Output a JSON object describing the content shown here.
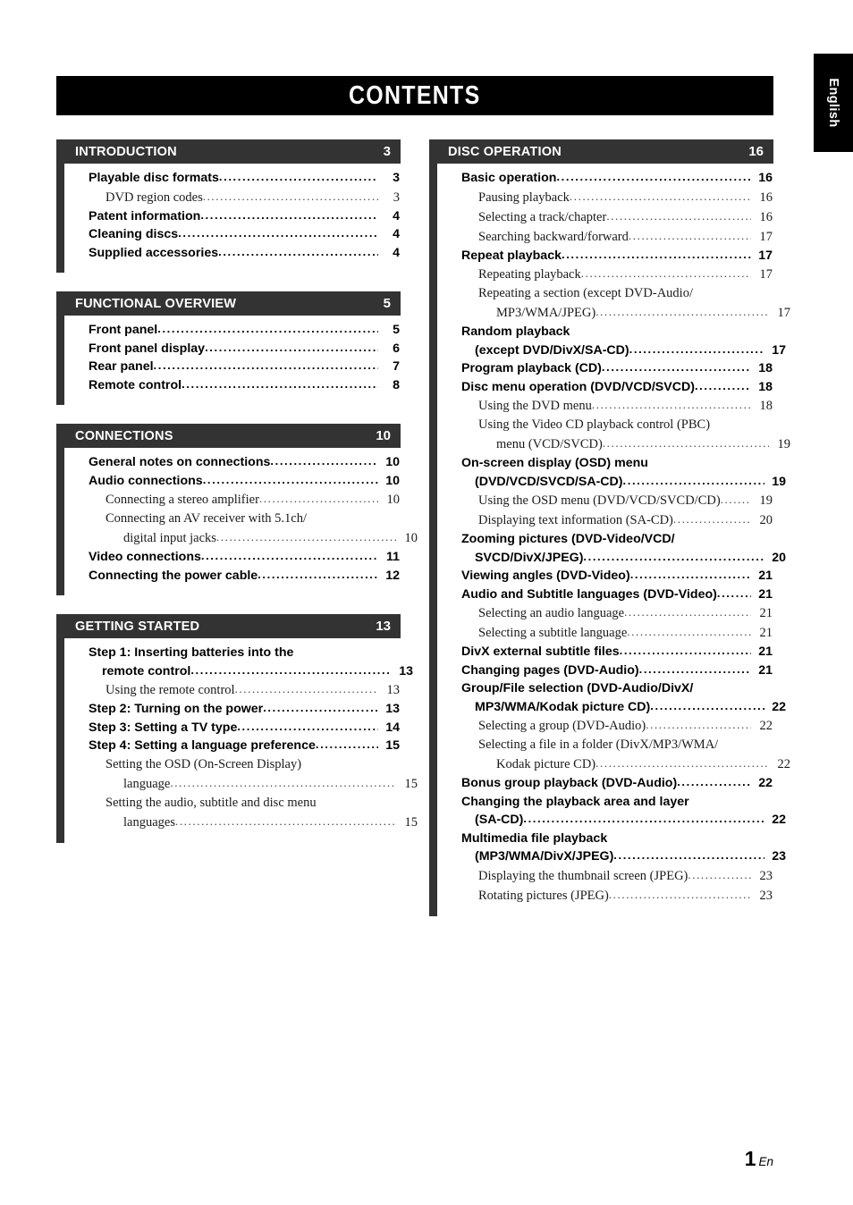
{
  "page": {
    "title": "CONTENTS",
    "language_tab": "English",
    "footer_number": "1",
    "footer_suffix": "En",
    "colors": {
      "title_bar": "#000000",
      "section_bar": "#333333",
      "text": "#000000",
      "background": "#ffffff"
    }
  },
  "columns": [
    {
      "id": "left",
      "sections": [
        {
          "name": "INTRODUCTION",
          "page": "3",
          "entries": [
            {
              "level": 1,
              "lines": [
                "Playable disc formats"
              ],
              "page": "3"
            },
            {
              "level": 2,
              "lines": [
                "DVD region codes"
              ],
              "page": "3"
            },
            {
              "level": 1,
              "lines": [
                "Patent information"
              ],
              "page": "4"
            },
            {
              "level": 1,
              "lines": [
                "Cleaning discs"
              ],
              "page": "4"
            },
            {
              "level": 1,
              "lines": [
                "Supplied accessories"
              ],
              "page": "4"
            }
          ]
        },
        {
          "name": "FUNCTIONAL OVERVIEW",
          "page": "5",
          "entries": [
            {
              "level": 1,
              "lines": [
                "Front panel"
              ],
              "page": "5"
            },
            {
              "level": 1,
              "lines": [
                "Front panel display"
              ],
              "page": "6"
            },
            {
              "level": 1,
              "lines": [
                "Rear panel"
              ],
              "page": "7"
            },
            {
              "level": 1,
              "lines": [
                "Remote control"
              ],
              "page": "8"
            }
          ]
        },
        {
          "name": "CONNECTIONS",
          "page": "10",
          "entries": [
            {
              "level": 1,
              "lines": [
                "General notes on connections"
              ],
              "page": "10"
            },
            {
              "level": 1,
              "lines": [
                "Audio connections"
              ],
              "page": "10"
            },
            {
              "level": 2,
              "lines": [
                "Connecting a stereo amplifier"
              ],
              "page": "10"
            },
            {
              "level": 2,
              "lines": [
                "Connecting an AV receiver with 5.1ch/",
                "digital input jacks"
              ],
              "page": "10"
            },
            {
              "level": 1,
              "lines": [
                "Video connections"
              ],
              "page": "11"
            },
            {
              "level": 1,
              "lines": [
                "Connecting the power cable"
              ],
              "page": "12"
            }
          ]
        },
        {
          "name": "GETTING STARTED",
          "page": "13",
          "entries": [
            {
              "level": 1,
              "lines": [
                "Step 1: Inserting batteries into the",
                "remote control"
              ],
              "page": "13"
            },
            {
              "level": 2,
              "lines": [
                "Using the remote control"
              ],
              "page": "13"
            },
            {
              "level": 1,
              "lines": [
                "Step 2: Turning on the power"
              ],
              "page": "13"
            },
            {
              "level": 1,
              "lines": [
                "Step 3: Setting a TV type"
              ],
              "page": "14"
            },
            {
              "level": 1,
              "lines": [
                "Step 4: Setting a language preference"
              ],
              "page": "15"
            },
            {
              "level": 2,
              "lines": [
                "Setting the OSD (On-Screen Display)",
                "language"
              ],
              "page": "15"
            },
            {
              "level": 2,
              "lines": [
                "Setting the audio, subtitle and disc menu",
                "languages"
              ],
              "page": "15"
            }
          ]
        }
      ]
    },
    {
      "id": "right",
      "sections": [
        {
          "name": "DISC OPERATION",
          "page": "16",
          "entries": [
            {
              "level": 1,
              "lines": [
                "Basic operation"
              ],
              "page": "16"
            },
            {
              "level": 2,
              "lines": [
                "Pausing playback"
              ],
              "page": "16"
            },
            {
              "level": 2,
              "lines": [
                "Selecting a track/chapter"
              ],
              "page": "16"
            },
            {
              "level": 2,
              "lines": [
                "Searching backward/forward"
              ],
              "page": "17"
            },
            {
              "level": 1,
              "lines": [
                "Repeat playback"
              ],
              "page": "17"
            },
            {
              "level": 2,
              "lines": [
                "Repeating playback"
              ],
              "page": "17"
            },
            {
              "level": 2,
              "lines": [
                "Repeating a section (except DVD-Audio/",
                "MP3/WMA/JPEG)"
              ],
              "page": "17"
            },
            {
              "level": 1,
              "lines": [
                "Random playback",
                "(except DVD/DivX/SA-CD)"
              ],
              "page": "17"
            },
            {
              "level": 1,
              "lines": [
                "Program playback (CD)"
              ],
              "page": "18"
            },
            {
              "level": 1,
              "lines": [
                "Disc menu operation (DVD/VCD/SVCD)"
              ],
              "page": "18"
            },
            {
              "level": 2,
              "lines": [
                "Using the DVD menu"
              ],
              "page": "18"
            },
            {
              "level": 2,
              "lines": [
                "Using the Video CD playback control (PBC)",
                "menu (VCD/SVCD)"
              ],
              "page": "19"
            },
            {
              "level": 1,
              "lines": [
                "On-screen display (OSD) menu",
                "(DVD/VCD/SVCD/SA-CD)"
              ],
              "page": "19"
            },
            {
              "level": 2,
              "lines": [
                "Using the OSD menu (DVD/VCD/SVCD/CD)"
              ],
              "page": "19"
            },
            {
              "level": 2,
              "lines": [
                "Displaying text information (SA-CD)"
              ],
              "page": "20"
            },
            {
              "level": 1,
              "lines": [
                "Zooming pictures (DVD-Video/VCD/",
                "SVCD/DivX/JPEG)"
              ],
              "page": "20"
            },
            {
              "level": 1,
              "lines": [
                "Viewing angles (DVD-Video)"
              ],
              "page": "21"
            },
            {
              "level": 1,
              "lines": [
                "Audio and Subtitle languages (DVD-Video)"
              ],
              "page": "21"
            },
            {
              "level": 2,
              "lines": [
                "Selecting an audio language"
              ],
              "page": "21"
            },
            {
              "level": 2,
              "lines": [
                "Selecting a subtitle language"
              ],
              "page": "21"
            },
            {
              "level": 1,
              "lines": [
                "DivX external subtitle files"
              ],
              "page": "21"
            },
            {
              "level": 1,
              "lines": [
                "Changing pages (DVD-Audio)"
              ],
              "page": "21"
            },
            {
              "level": 1,
              "lines": [
                "Group/File selection (DVD-Audio/DivX/",
                "MP3/WMA/Kodak picture CD)"
              ],
              "page": "22"
            },
            {
              "level": 2,
              "lines": [
                "Selecting a group (DVD-Audio)"
              ],
              "page": "22"
            },
            {
              "level": 2,
              "lines": [
                "Selecting a file in a folder (DivX/MP3/WMA/",
                "Kodak picture CD)"
              ],
              "page": "22"
            },
            {
              "level": 1,
              "lines": [
                "Bonus group playback (DVD-Audio)"
              ],
              "page": "22"
            },
            {
              "level": 1,
              "lines": [
                "Changing the playback area and layer",
                "(SA-CD)"
              ],
              "page": "22"
            },
            {
              "level": 1,
              "lines": [
                "Multimedia file playback",
                "(MP3/WMA/DivX/JPEG)"
              ],
              "page": "23"
            },
            {
              "level": 2,
              "lines": [
                "Displaying the thumbnail screen (JPEG)"
              ],
              "page": "23"
            },
            {
              "level": 2,
              "lines": [
                "Rotating pictures (JPEG)"
              ],
              "page": "23"
            }
          ]
        }
      ]
    }
  ]
}
